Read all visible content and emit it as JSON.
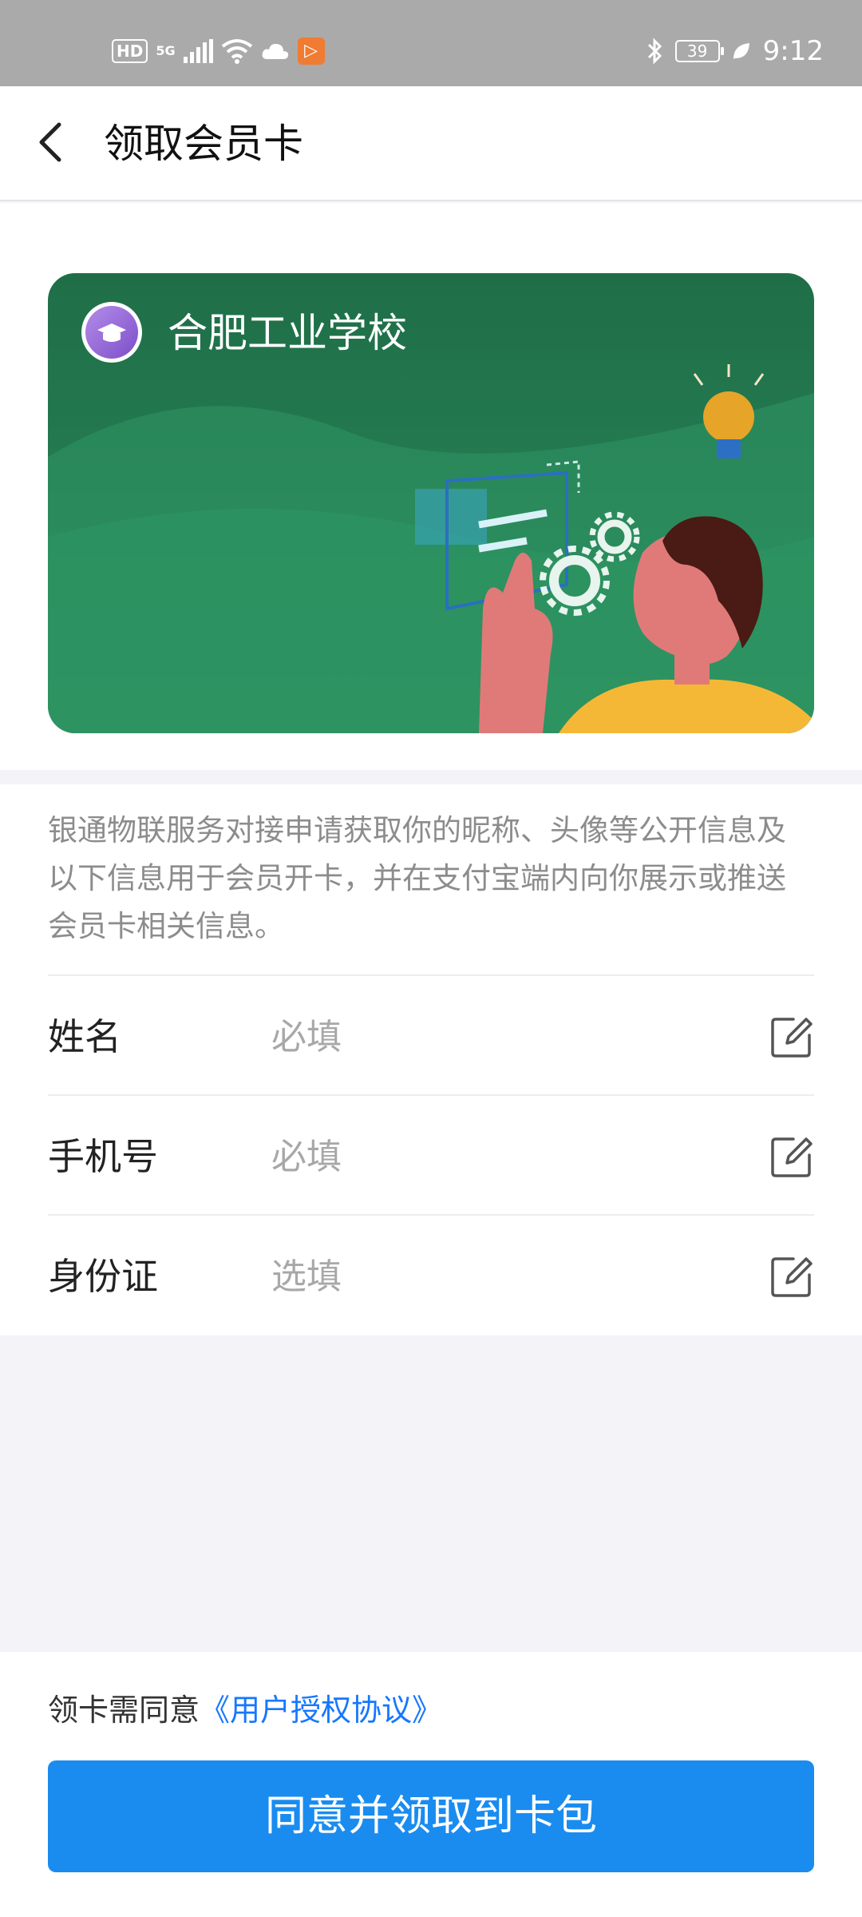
{
  "status_bar": {
    "hd": "HD",
    "network": "5G",
    "battery": "39",
    "time": "9:12"
  },
  "nav": {
    "title": "领取会员卡"
  },
  "card": {
    "school_name": "合肥工业学校",
    "theme_color": "#2a8a5c"
  },
  "notice": {
    "text": "银通物联服务对接申请获取你的昵称、头像等公开信息及以下信息用于会员开卡，并在支付宝端内向你展示或推送会员卡相关信息。"
  },
  "form": {
    "fields": [
      {
        "label": "姓名",
        "placeholder": "必填"
      },
      {
        "label": "手机号",
        "placeholder": "必填"
      },
      {
        "label": "身份证",
        "placeholder": "选填"
      }
    ]
  },
  "footer": {
    "agree_prefix": "领卡需同意",
    "agree_link": "《用户授权协议》",
    "button_label": "同意并领取到卡包",
    "button_color": "#1a8cf0",
    "link_color": "#1677ff"
  }
}
